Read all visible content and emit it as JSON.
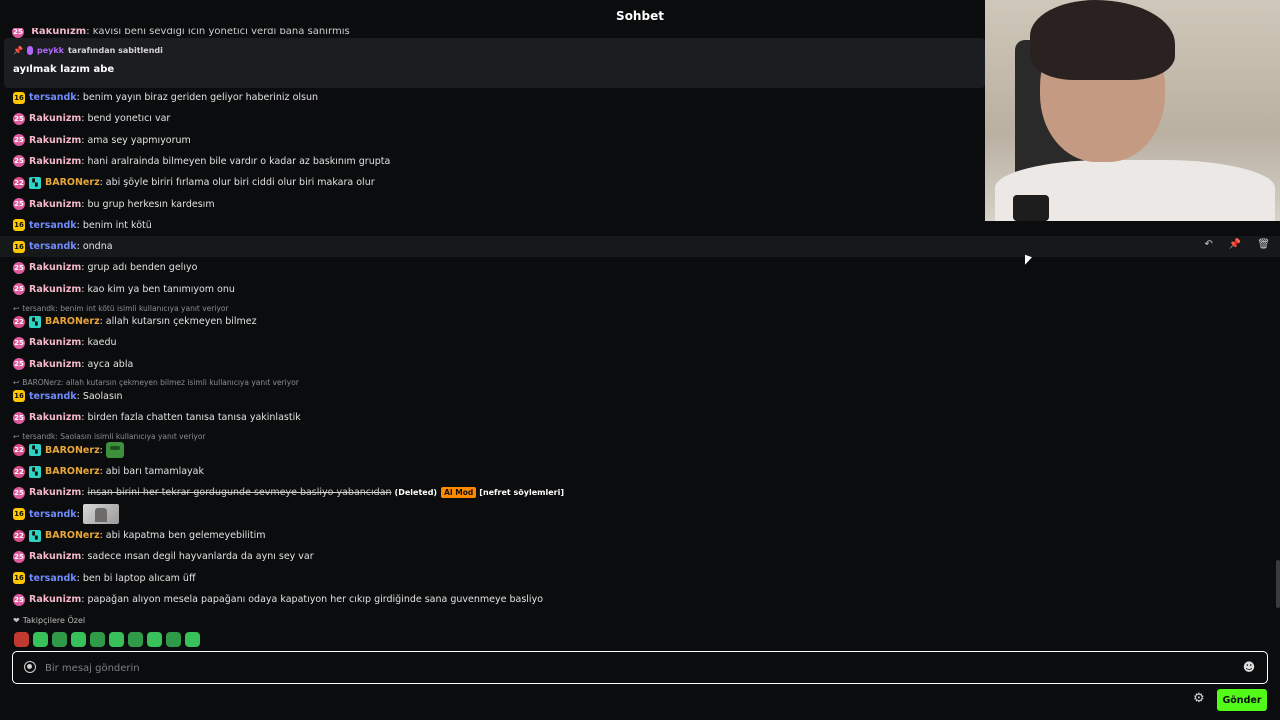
{
  "chat_title": "Sohbet",
  "cut_message": {
    "user": "Rakunizm",
    "text": "kavisi beni sevdigi icin yonetici verdi bana sanirmis"
  },
  "pinned": {
    "pinned_by": "peykk",
    "pinned_by_suffix": "tarafından sabitlendi",
    "text": "ayılmak lazım abe"
  },
  "messages": [
    {
      "badge": "16",
      "user": "tersandk",
      "text": "benim yayın biraz geriden geliyor haberiniz olsun"
    },
    {
      "badge": "25",
      "user": "Rakunizm",
      "text": "bend yonetıcı var"
    },
    {
      "badge": "25",
      "user": "Rakunizm",
      "text": "ama sey yapmıyorum"
    },
    {
      "badge": "25",
      "user": "Rakunizm",
      "text": "hani aralrainda bilmeyen bile vardır o kadar az baskınım grupta"
    },
    {
      "badge": "22",
      "user": "BARONerz",
      "text": "abi şöyle biriri fırlama olur biri ciddi olur biri makara olur"
    },
    {
      "badge": "25",
      "user": "Rakunizm",
      "text": "bu grup herkesın kardesım"
    },
    {
      "badge": "16",
      "user": "tersandk",
      "text": "benim int kötü"
    },
    {
      "badge": "16",
      "user": "tersandk",
      "text": "ondna"
    },
    {
      "badge": "25",
      "user": "Rakunizm",
      "text": "grup adı benden gelıyo"
    },
    {
      "badge": "25",
      "user": "Rakunizm",
      "text": "kao kim ya ben tanımıyom onu"
    },
    {
      "reply": "tersandk: benim int kötü isimli kullanıcıya yanıt veriyor"
    },
    {
      "badge": "22",
      "user": "BARONerz",
      "text": "allah kutarsın çekmeyen bilmez"
    },
    {
      "badge": "25",
      "user": "Rakunizm",
      "text": "kaedu"
    },
    {
      "badge": "25",
      "user": "Rakunizm",
      "text": "ayca abla"
    },
    {
      "reply": "BARONerz: allah kutarsın çekmeyen bilmez isimli kullanıcıya yanıt veriyor"
    },
    {
      "badge": "16",
      "user": "tersandk",
      "text": "Saolasın"
    },
    {
      "badge": "25",
      "user": "Rakunizm",
      "text": "birden fazla chatten tanısa tanısa yakinlastik"
    },
    {
      "reply": "tersandk: Saolasın isimli kullanıcıya yanıt veriyor"
    },
    {
      "badge": "22",
      "user": "BARONerz",
      "text": ""
    },
    {
      "badge": "22",
      "user": "BARONerz",
      "text": "abi barı tamamlayak"
    },
    {
      "badge": "25",
      "user": "Rakunizm",
      "text": "insan birini her tekrar gordugunde sevmeye basliyo yabancıdan",
      "deleted": "(Deleted)",
      "ai_mod": "AI Mod",
      "ai_category": "[nefret söylemleri]"
    },
    {
      "badge": "16",
      "user": "tersandk",
      "text": ""
    },
    {
      "badge": "22",
      "user": "BARONerz",
      "text": "abi kapatma ben gelemeyebilitim"
    },
    {
      "badge": "25",
      "user": "Rakunizm",
      "text": "sadece ınsan degil hayvanlarda da aynı sey var"
    },
    {
      "badge": "16",
      "user": "tersandk",
      "text": "ben bi laptop alıcam üff"
    },
    {
      "badge": "25",
      "user": "Rakunizm",
      "text": "papağan alıyon mesela papağanı odaya kapatıyon her cıkıp girdiğinde sana guvenmeye basliyo"
    }
  ],
  "follower_label": "Takipçilere Özel",
  "input": {
    "placeholder": "Bir mesaj gönderin",
    "value": ""
  },
  "send_label": "Gönder",
  "colors": {
    "accent": "#53fc18",
    "tersandk": "#6f8bff",
    "rakunizm": "#f3b7c9",
    "baronerz": "#e8a63a",
    "ai_mod": "#ff8a00"
  }
}
